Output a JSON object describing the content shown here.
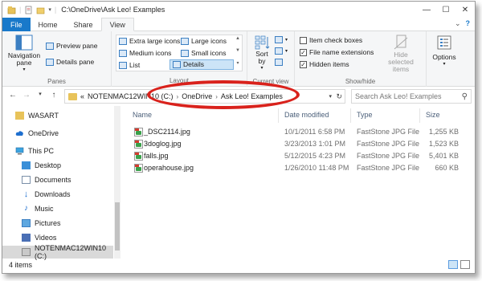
{
  "window": {
    "title": "C:\\OneDrive\\Ask Leo! Examples"
  },
  "ribbon_tabs": [
    "File",
    "Home",
    "Share",
    "View"
  ],
  "ribbon": {
    "panes": {
      "navigation_pane": "Navigation pane",
      "preview_pane": "Preview pane",
      "details_pane": "Details pane",
      "group_label": "Panes"
    },
    "layout": {
      "extra_large_icons": "Extra large icons",
      "large_icons": "Large icons",
      "medium_icons": "Medium icons",
      "small_icons": "Small icons",
      "list": "List",
      "details": "Details",
      "group_label": "Layout"
    },
    "current_view": {
      "sort_by": "Sort by",
      "group_label": "Current view"
    },
    "show_hide": {
      "item_check_boxes": {
        "label": "Item check boxes",
        "checked": false
      },
      "file_name_extensions": {
        "label": "File name extensions",
        "checked": true
      },
      "hidden_items": {
        "label": "Hidden items",
        "checked": true
      },
      "hide_selected_items": "Hide selected items",
      "group_label": "Show/hide"
    },
    "options": "Options"
  },
  "address_bar": {
    "overflow": "«",
    "crumbs": [
      "NOTENMAC12WIN10 (C:)",
      "OneDrive",
      "Ask Leo! Examples"
    ]
  },
  "search": {
    "placeholder": "Search Ask Leo! Examples"
  },
  "nav_pane": {
    "items": [
      {
        "label": "WASART",
        "icon": "folder-icon"
      },
      {
        "label": "OneDrive",
        "icon": "cloud-icon"
      },
      {
        "label": "This PC",
        "icon": "computer-icon"
      },
      {
        "label": "Desktop",
        "icon": "desktop-icon"
      },
      {
        "label": "Documents",
        "icon": "documents-icon"
      },
      {
        "label": "Downloads",
        "icon": "downloads-icon"
      },
      {
        "label": "Music",
        "icon": "music-icon"
      },
      {
        "label": "Pictures",
        "icon": "pictures-icon"
      },
      {
        "label": "Videos",
        "icon": "videos-icon"
      },
      {
        "label": "NOTENMAC12WIN10 (C:)",
        "icon": "drive-icon"
      }
    ]
  },
  "columns": {
    "name": "Name",
    "date_modified": "Date modified",
    "type": "Type",
    "size": "Size"
  },
  "files": [
    {
      "name": "_DSC2114.jpg",
      "date": "10/1/2011 6:58 PM",
      "type": "FastStone JPG File",
      "size": "1,255 KB"
    },
    {
      "name": "3doglog.jpg",
      "date": "3/23/2013 1:01 PM",
      "type": "FastStone JPG File",
      "size": "1,523 KB"
    },
    {
      "name": "falls.jpg",
      "date": "5/12/2015 4:23 PM",
      "type": "FastStone JPG File",
      "size": "5,401 KB"
    },
    {
      "name": "operahouse.jpg",
      "date": "1/26/2010 11:48 PM",
      "type": "FastStone JPG File",
      "size": "660 KB"
    }
  ],
  "status": {
    "item_count": "4 items"
  },
  "colors": {
    "file_tab": "#1979ca",
    "annotation_ellipse": "#d9221c",
    "selection": "#cce4f7"
  }
}
